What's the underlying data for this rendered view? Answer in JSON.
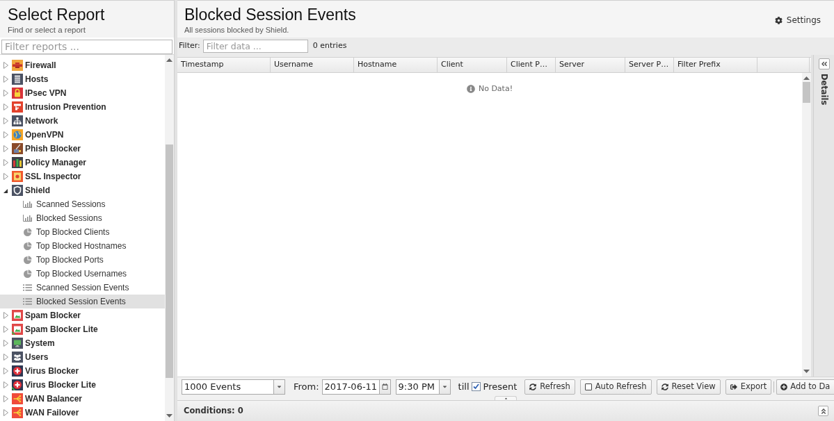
{
  "sidebar": {
    "title": "Select Report",
    "subtitle": "Find or select a report",
    "filter": {
      "placeholder": "Filter reports ..."
    },
    "tree": [
      {
        "label": "Firewall",
        "kind": "wall",
        "color": "#f0a43a",
        "expanded": false
      },
      {
        "label": "Hosts",
        "kind": "server",
        "color": "#4b5263",
        "expanded": false
      },
      {
        "label": "IPsec VPN",
        "kind": "padlock",
        "color": "#d8333a",
        "expanded": false
      },
      {
        "label": "Intrusion Prevention",
        "kind": "alarm",
        "color": "#e2412c",
        "expanded": false
      },
      {
        "label": "Network",
        "kind": "network",
        "color": "#4b5263",
        "expanded": false
      },
      {
        "label": "OpenVPN",
        "kind": "globe",
        "color": "#f5a524",
        "expanded": false
      },
      {
        "label": "Phish Blocker",
        "kind": "phish",
        "color": "#8a4a2a",
        "expanded": false
      },
      {
        "label": "Policy Manager",
        "kind": "bars",
        "color": "#3d4048",
        "expanded": false
      },
      {
        "label": "SSL Inspector",
        "kind": "certificate",
        "color": "#f0582e",
        "expanded": false
      },
      {
        "label": "Shield",
        "kind": "shield",
        "color": "#4b5263",
        "expanded": true,
        "children": [
          {
            "label": "Scanned Sessions",
            "kind": "bar",
            "selected": false
          },
          {
            "label": "Blocked Sessions",
            "kind": "bar",
            "selected": false
          },
          {
            "label": "Top Blocked Clients",
            "kind": "pie",
            "selected": false
          },
          {
            "label": "Top Blocked Hostnames",
            "kind": "pie",
            "selected": false
          },
          {
            "label": "Top Blocked Ports",
            "kind": "pie",
            "selected": false
          },
          {
            "label": "Top Blocked Usernames",
            "kind": "pie",
            "selected": false
          },
          {
            "label": "Scanned Session Events",
            "kind": "list",
            "selected": false
          },
          {
            "label": "Blocked Session Events",
            "kind": "list",
            "selected": true
          }
        ]
      },
      {
        "label": "Spam Blocker",
        "kind": "mail",
        "color": "#e04848",
        "expanded": false
      },
      {
        "label": "Spam Blocker Lite",
        "kind": "maillite",
        "color": "#e04848",
        "expanded": false
      },
      {
        "label": "System",
        "kind": "monitor",
        "color": "#4b5263",
        "expanded": false
      },
      {
        "label": "Users",
        "kind": "users",
        "color": "#4b5263",
        "expanded": false
      },
      {
        "label": "Virus Blocker",
        "kind": "cross",
        "color": "#2d3752",
        "expanded": false
      },
      {
        "label": "Virus Blocker Lite",
        "kind": "crosslite",
        "color": "#2d3752",
        "expanded": false
      },
      {
        "label": "WAN Balancer",
        "kind": "arrows",
        "color": "#f04a3a",
        "expanded": false
      },
      {
        "label": "WAN Failover",
        "kind": "arrows",
        "color": "#f04a3a",
        "expanded": false
      }
    ]
  },
  "main": {
    "title": "Blocked Session Events",
    "subtitle": "All sessions blocked by Shield.",
    "settings": "Settings",
    "filter": {
      "label": "Filter:",
      "placeholder": "Filter data ...",
      "count": "0 entries"
    },
    "columns": [
      "Timestamp",
      "Username",
      "Hostname",
      "Client",
      "Client P…",
      "Server",
      "Server P…",
      "Filter Prefix"
    ],
    "empty_message": "No Data!",
    "details": {
      "label": "Details"
    },
    "toolbar": {
      "limit": "1000 Events",
      "from_label": "From:",
      "date": "2017-06-11",
      "time": "9:30 PM",
      "till_label": "till",
      "present": {
        "label": "Present",
        "checked": true
      },
      "refresh": {
        "label": "Refresh"
      },
      "auto_refresh": {
        "label": "Auto Refresh",
        "checked": false
      },
      "reset": {
        "label": "Reset View"
      },
      "export": {
        "label": "Export"
      },
      "add": {
        "label": "Add to Da"
      }
    },
    "conditions": "Conditions: 0"
  }
}
